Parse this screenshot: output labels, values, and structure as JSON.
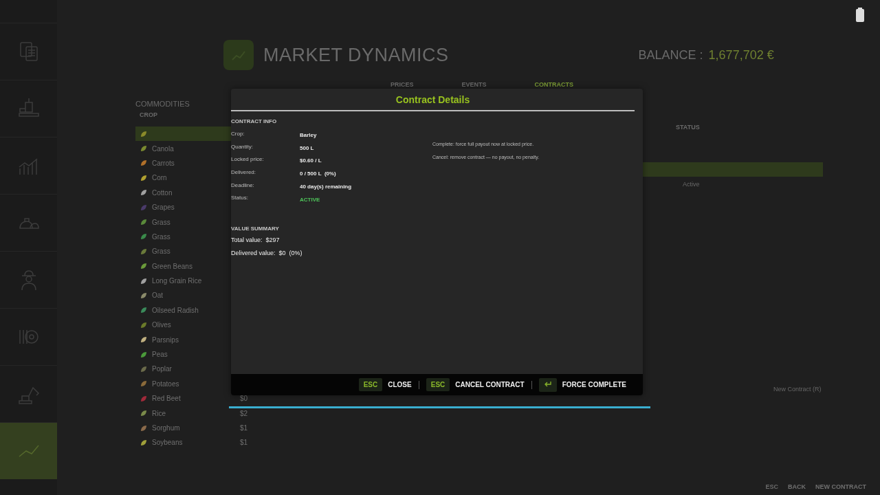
{
  "sidebar": {
    "items": [
      {
        "kind": "documents",
        "selected": false
      },
      {
        "kind": "factory",
        "selected": false
      },
      {
        "kind": "chart",
        "selected": false
      },
      {
        "kind": "animals",
        "selected": false
      },
      {
        "kind": "farmer",
        "selected": false
      },
      {
        "kind": "settings",
        "selected": false
      },
      {
        "kind": "excavator",
        "selected": false
      },
      {
        "kind": "trend",
        "selected": true
      }
    ]
  },
  "header": {
    "title": "MARKET DYNAMICS",
    "balance_label": "BALANCE :",
    "balance_value": "1,677,702 €"
  },
  "tabs": [
    {
      "label": "PRICES",
      "selected": false
    },
    {
      "label": "EVENTS",
      "selected": false
    },
    {
      "label": "CONTRACTS",
      "selected": true
    }
  ],
  "commodities": {
    "title": "COMMODITIES",
    "column": "CROP",
    "rows": [
      {
        "selected": true,
        "color": "#8a8a2a"
      },
      {
        "name": "Canola",
        "selected": false,
        "color": "#7a8a30"
      },
      {
        "name": "Carrots",
        "selected": false,
        "color": "#b0702a"
      },
      {
        "name": "Corn",
        "selected": false,
        "color": "#b0a030"
      },
      {
        "name": "Cotton",
        "selected": false,
        "color": "#a0a0a0"
      },
      {
        "name": "Grapes",
        "selected": false,
        "color": "#4a3a6a"
      },
      {
        "name": "Grass",
        "selected": false,
        "color": "#5a8a3a"
      },
      {
        "name": "Grass",
        "selected": false,
        "color": "#3a8a4a"
      },
      {
        "name": "Grass",
        "selected": false,
        "color": "#6a7a3a"
      },
      {
        "name": "Green Beans",
        "selected": false,
        "color": "#6a9a3a"
      },
      {
        "name": "Long Grain Rice",
        "selected": false,
        "color": "#a0a0a0"
      },
      {
        "name": "Oat",
        "selected": false,
        "color": "#8a8a6a"
      },
      {
        "name": "Oilseed Radish",
        "selected": false,
        "color": "#3a8a5a"
      },
      {
        "name": "Olives",
        "selected": false,
        "color": "#6a7a2a"
      },
      {
        "name": "Parsnips",
        "selected": false,
        "color": "#c0b080"
      },
      {
        "name": "Peas",
        "selected": false,
        "color": "#4a9a3a"
      },
      {
        "name": "Poplar",
        "selected": false,
        "color": "#6a6a4a"
      },
      {
        "name": "Potatoes",
        "selected": false,
        "color": "#8a6a3a"
      },
      {
        "name": "Red Beet",
        "price": "$0",
        "selected": false,
        "color": "#a02a3a"
      },
      {
        "name": "Rice",
        "price": "$2",
        "selected": false,
        "color": "#7a8a4a"
      },
      {
        "name": "Sorghum",
        "price": "$1",
        "selected": false,
        "color": "#8a6a4a"
      },
      {
        "name": "Soybeans",
        "price": "$1",
        "selected": false,
        "color": "#a0a03a"
      }
    ]
  },
  "contracts": {
    "column": "STATUS",
    "rows": [
      {
        "selected": true
      },
      {
        "status": "Active",
        "selected": false
      }
    ],
    "hint": "New Contract (R)"
  },
  "footer": [
    {
      "key": "ESC",
      "label": "BACK"
    },
    {
      "label": "NEW CONTRACT"
    }
  ],
  "dialog": {
    "title": "Contract Details",
    "info_heading": "CONTRACT INFO",
    "fields": [
      {
        "label": "Crop:",
        "value": "Barley",
        "kind": "plain"
      },
      {
        "label": "Quantity:",
        "value": "500 L",
        "kind": "plain"
      },
      {
        "label": "Locked price:",
        "value": "$0.60 / L",
        "kind": "plain"
      },
      {
        "label": "Delivered:",
        "value": "0 / 500 L  (0%)",
        "kind": "plain"
      },
      {
        "label": "Deadline:",
        "value": "40 day(s) remaining",
        "kind": "plain"
      },
      {
        "label": "Status:",
        "value": "ACTIVE",
        "kind": "status"
      }
    ],
    "notes": [
      "Complete: force full payout now at locked price.",
      "Cancel: remove contract — no payout, no penalty."
    ],
    "summary_heading": "VALUE SUMMARY",
    "summary": [
      "Total value:  $297",
      "Delivered value:  $0  (0%)"
    ],
    "actions": [
      {
        "key": "ESC",
        "label": "CLOSE",
        "kind": "text"
      },
      {
        "key": "ESC",
        "label": "CANCEL CONTRACT",
        "kind": "text"
      },
      {
        "label": "FORCE COMPLETE",
        "kind": "enter"
      }
    ]
  }
}
